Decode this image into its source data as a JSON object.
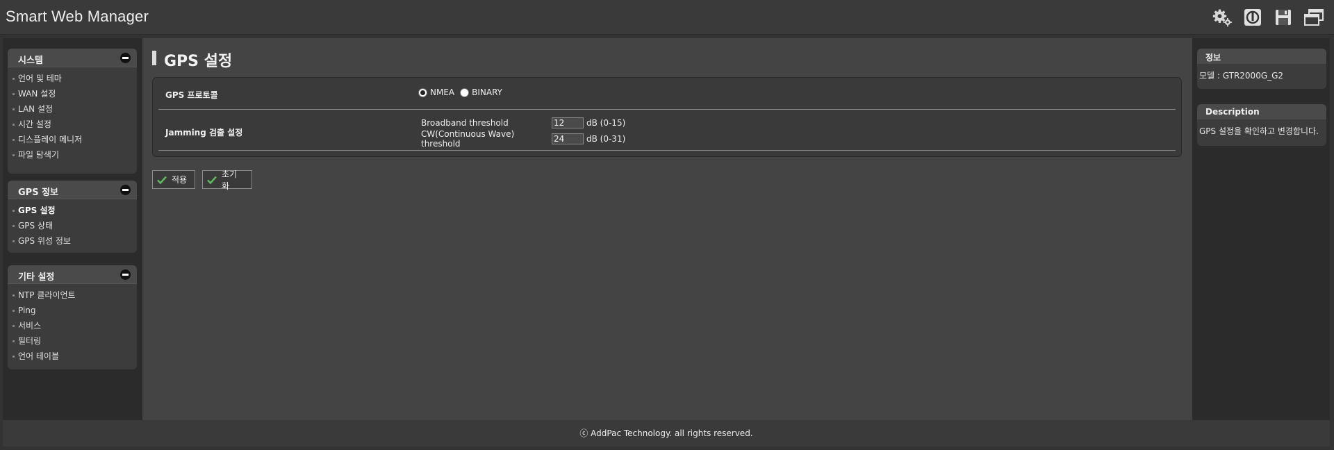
{
  "header": {
    "title": "Smart Web Manager",
    "icons": [
      "settings-gears-icon",
      "power-icon",
      "save-disk-icon",
      "windows-icon"
    ]
  },
  "sidebar": {
    "groups": [
      {
        "title": "시스템",
        "items": [
          "언어 및 테마",
          "WAN 설정",
          "LAN 설정",
          "시간 설정",
          "디스플레이 메니저",
          "파일 탐색기"
        ]
      },
      {
        "title": "GPS 정보",
        "items": [
          "GPS 설정",
          "GPS 상태",
          "GPS 위성 정보"
        ],
        "active": "GPS 설정"
      },
      {
        "title": "기타 설정",
        "items": [
          "NTP 클라이언트",
          "Ping",
          "서비스",
          "필터링",
          "언어 테이블"
        ]
      }
    ]
  },
  "main": {
    "page_title": "GPS 설정",
    "protocol": {
      "label": "GPS 프로토콜",
      "options": [
        "NMEA",
        "BINARY"
      ],
      "selected": "NMEA"
    },
    "jamming": {
      "label": "Jamming 검출 설정",
      "broadband": {
        "label": "Broadband threshold",
        "value": "12",
        "unit": "dB (0-15)"
      },
      "cw": {
        "label": "CW(Continuous Wave) threshold",
        "value": "24",
        "unit": "dB (0-31)"
      }
    },
    "buttons": {
      "apply": "적용",
      "reset": "초기화"
    }
  },
  "rightbar": {
    "info_title": "정보",
    "model": "모델 : GTR2000G_G2",
    "desc_title": "Description",
    "desc_text": "GPS 설정을 확인하고 변경합니다."
  },
  "footer": {
    "text": "ⓒ AddPac Technology. all rights reserved."
  },
  "colors": {
    "background": "#333333",
    "panel": "#3a3a3a",
    "main": "#444444",
    "check": "#5fb75f"
  }
}
